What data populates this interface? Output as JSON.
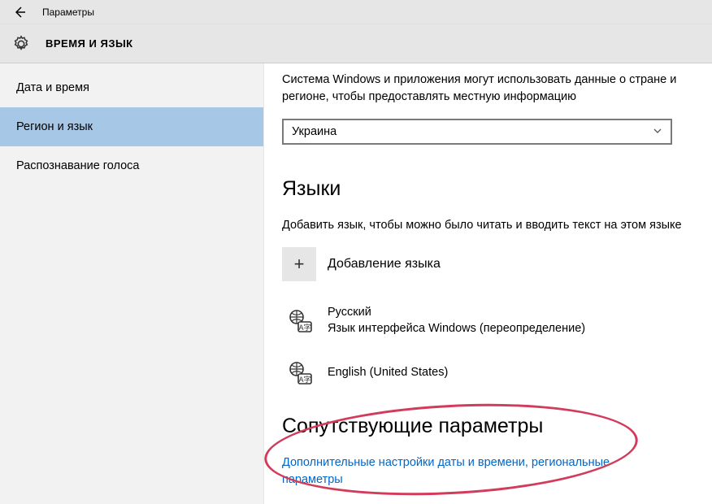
{
  "header": {
    "window_title": "Параметры",
    "section_title": "ВРЕМЯ И ЯЗЫК"
  },
  "sidebar": {
    "items": [
      {
        "label": "Дата и время"
      },
      {
        "label": "Регион и язык"
      },
      {
        "label": "Распознавание голоса"
      }
    ]
  },
  "main": {
    "region_desc": "Система Windows и приложения могут использовать данные о стране и регионе, чтобы предоставлять местную информацию",
    "region_selected": "Украина",
    "languages_heading": "Языки",
    "languages_desc": "Добавить язык, чтобы можно было читать и вводить текст на этом языке",
    "add_language_label": "Добавление языка",
    "lang1": {
      "name": "Русский",
      "sub": "Язык интерфейса Windows (переопределение)"
    },
    "lang2": {
      "name": "English (United States)",
      "sub": ""
    },
    "related_heading": "Сопутствующие параметры",
    "related_link": "Дополнительные настройки даты и времени, региональные параметры"
  }
}
